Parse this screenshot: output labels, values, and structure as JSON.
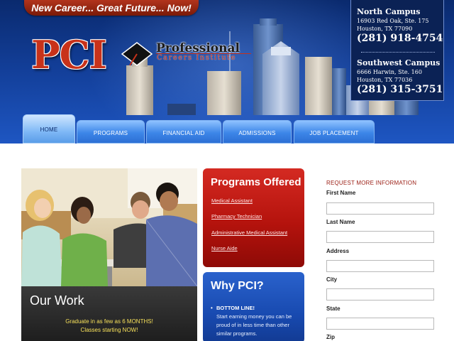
{
  "header": {
    "tagline": "New Career... Great Future...  Now!",
    "logo": {
      "mark": "PCI",
      "name_line1": "Professional",
      "name_line2": "Careers Institute"
    }
  },
  "campuses": [
    {
      "name": "North Campus",
      "address_line1": "16903 Red Oak, Ste. 175",
      "address_line2": "Houston, TX 77090",
      "phone": "(281) 918-4754"
    },
    {
      "name": "Southwest Campus",
      "address_line1": "6666 Harwin, Ste. 160",
      "address_line2": "Houston, TX 77036",
      "phone": "(281) 315-3751"
    }
  ],
  "nav": {
    "items": [
      {
        "label": "HOME",
        "active": true
      },
      {
        "label": "PROGRAMS",
        "active": false
      },
      {
        "label": "FINANCIAL AID",
        "active": false
      },
      {
        "label": "ADMISSIONS",
        "active": false
      },
      {
        "label": "JOB PLACEMENT",
        "active": false
      }
    ]
  },
  "our_work": {
    "title": "Our Work",
    "line1": "Graduate in as few as 6 MONTHS!",
    "line2": "Classes starting NOW!"
  },
  "programs": {
    "title": "Programs Offered",
    "links": [
      "Medical Assistant",
      "Pharmacy Technician",
      "Administrative Medical Assistant",
      "Nurse Aide"
    ]
  },
  "why": {
    "title": "Why PCI?",
    "bullet_title": "BOTTOM LINE!",
    "bullet_body": "Start earning money you can be proud of in less time than other similar programs."
  },
  "form": {
    "title": "REQUEST MORE INFORMATION",
    "fields": [
      {
        "label": "First Name",
        "value": ""
      },
      {
        "label": "Last Name",
        "value": ""
      },
      {
        "label": "Address",
        "value": ""
      },
      {
        "label": "City",
        "value": ""
      },
      {
        "label": "State",
        "value": ""
      },
      {
        "label": "Zip",
        "value": ""
      }
    ]
  },
  "colors": {
    "header_blue": "#123d96",
    "brand_red": "#c8321a",
    "programs_red": "#b5130d",
    "why_blue": "#184ab0",
    "nav_blue": "#3d86e8",
    "highlight_yellow": "#f6e05a"
  },
  "icons": {
    "logo_cap": "graduation-cap-icon"
  }
}
